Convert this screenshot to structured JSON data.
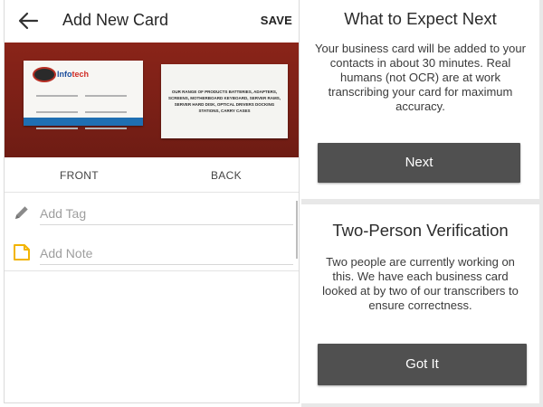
{
  "add_card": {
    "title": "Add New Card",
    "save_label": "SAVE",
    "tabs": {
      "front": "FRONT",
      "back": "BACK"
    },
    "fields": {
      "tag_placeholder": "Add Tag",
      "note_placeholder": "Add Note"
    },
    "card_front": {
      "company_prefix": "Info",
      "company_suffix": "tech"
    },
    "card_back": {
      "text": "OUR RANGE OF PRODUCTS BATTERIES, ADAPTERS, SCREENS, MOTHERBOARD KEYBOARD, SERVER RAMS, SERVER HARD DISK, OPTICAL DRIVERS DOCKING STATIONS, CARRY CASES"
    },
    "icons": {
      "back": "back-arrow-icon",
      "tag": "pencil-icon",
      "note": "note-icon"
    }
  },
  "expect_dialog": {
    "title": "What to Expect Next",
    "body": "Your business card will be added to your contacts in about 30 minutes. Real humans (not OCR) are at work transcribing your card for maximum accuracy.",
    "button": "Next"
  },
  "verify_dialog": {
    "title": "Two-Person Verification",
    "body": "Two people are currently working on this. We have each business card looked at by two of our transcribers to ensure correctness.",
    "button": "Got It"
  },
  "colors": {
    "button_bg": "#505050",
    "photo_bg": "#7a1f16",
    "note_icon": "#f2b400",
    "pencil_icon": "#8a8a8a",
    "card_strip": "#1f6fb2"
  }
}
